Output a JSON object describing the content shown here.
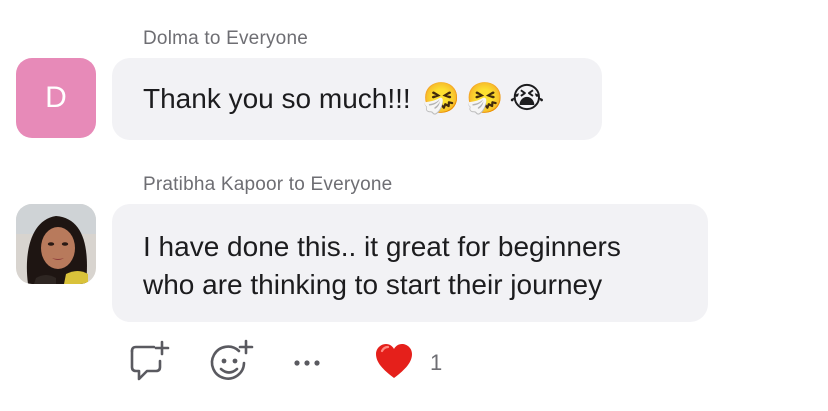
{
  "messages": [
    {
      "sender": "Dolma to Everyone",
      "avatar_letter": "D",
      "avatar_color": "#e78ab8",
      "text": "Thank you so much!!!",
      "emojis": [
        "🤧",
        "🤧",
        "😭"
      ]
    },
    {
      "sender": "Pratibha Kapoor to Everyone",
      "avatar_type": "photo",
      "lines": [
        "I have done this.. it great for beginners",
        "who are thinking to start their journey"
      ],
      "reactions": {
        "heart": {
          "emoji": "❤️",
          "count": "1"
        }
      }
    }
  ],
  "actions": {
    "icons": [
      "reply-icon",
      "add-reaction-icon",
      "more-icon"
    ]
  },
  "colors": {
    "bubble": "#f2f2f5",
    "meta_text": "#6e6e73",
    "icon": "#5a5a60"
  }
}
